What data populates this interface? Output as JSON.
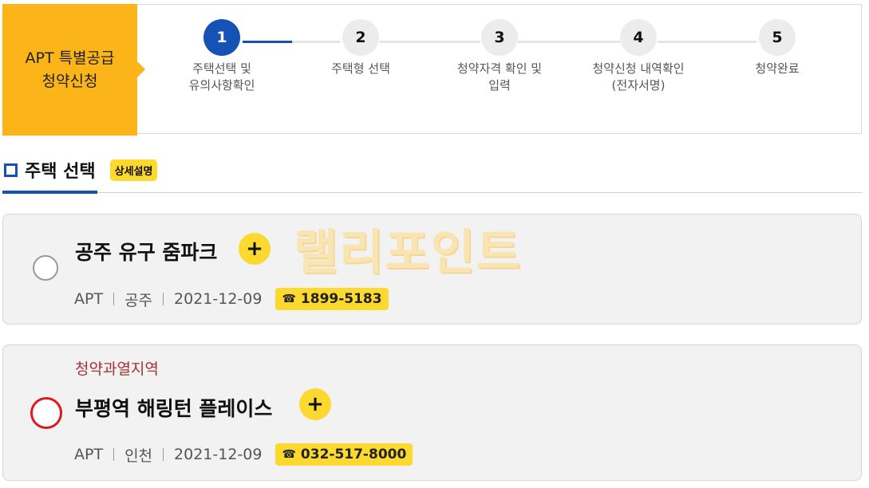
{
  "badge": {
    "line1": "APT 특별공급",
    "line2": "청약신청"
  },
  "steps": [
    {
      "number": "1",
      "label": "주택선택 및\n유의사항확인"
    },
    {
      "number": "2",
      "label": "주택형 선택"
    },
    {
      "number": "3",
      "label": "청약자격 확인 및\n입력"
    },
    {
      "number": "4",
      "label": "청약신청 내역확인\n(전자서명)"
    },
    {
      "number": "5",
      "label": "청약완료"
    }
  ],
  "current_step": 1,
  "section": {
    "title": "주택 선택",
    "detail_label": "상세설명"
  },
  "watermark": "랠리포인트",
  "cards": [
    {
      "region_label": "",
      "name": "공주 유구 줌파크",
      "plus": "+",
      "type": "APT",
      "region": "공주",
      "date": "2021-12-09",
      "phone_icon": "☎",
      "phone": "1899-5183"
    },
    {
      "region_label": "청약과열지역",
      "name": "부평역 해링턴 플레이스",
      "plus": "+",
      "type": "APT",
      "region": "인천",
      "date": "2021-12-09",
      "phone_icon": "☎",
      "phone": "032-517-8000"
    }
  ],
  "colors": {
    "accent_blue": "#1652b5",
    "badge_yellow": "#fbb519",
    "highlight_red": "#e01a1a"
  }
}
